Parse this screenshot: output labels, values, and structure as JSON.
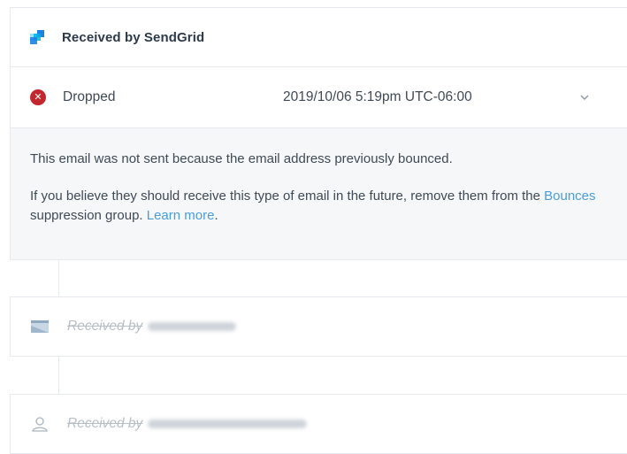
{
  "header": {
    "title": "Received by SendGrid",
    "logo_icon": "sendgrid-logo",
    "logo_colors": [
      "#1a82e2",
      "#99e1f4",
      "#00b3e3",
      "#263746"
    ]
  },
  "event": {
    "status_icon": "x-circle-icon",
    "status_color": "#c4262e",
    "status_label": "Dropped",
    "timestamp": "2019/10/06 5:19pm UTC-06:00",
    "expand_icon": "chevron-down-icon"
  },
  "detail": {
    "line1": "This email was not sent because the email address previously bounced.",
    "line2_prefix": "If you believe they should receive this type of email in the future, remove them from the ",
    "bounces_link": "Bounces",
    "line2_middle": " suppression group. ",
    "learn_more_link": "Learn more",
    "line2_suffix": ".",
    "link_color": "#4a9dd8"
  },
  "rows": [
    {
      "icon": "mail-server-icon",
      "label": "Received by"
    },
    {
      "icon": "user-icon",
      "label": "Received by"
    }
  ]
}
